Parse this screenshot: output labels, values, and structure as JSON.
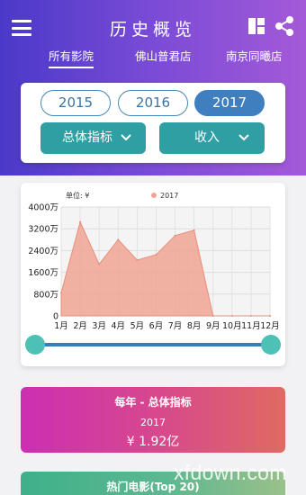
{
  "header": {
    "title": "历史概览",
    "icons": {
      "menu": "menu-icon",
      "grid": "grid-icon",
      "share": "share-icon"
    },
    "tabs": [
      {
        "label": "所有影院",
        "active": true
      },
      {
        "label": "佛山普君店",
        "active": false
      },
      {
        "label": "南京同曦店",
        "active": false
      }
    ]
  },
  "filters": {
    "years": [
      {
        "label": "2015",
        "active": false
      },
      {
        "label": "2016",
        "active": false
      },
      {
        "label": "2017",
        "active": true
      }
    ],
    "dropdowns": [
      {
        "label": "总体指标",
        "icon": "chevron-down-icon"
      },
      {
        "label": "收入",
        "icon": "chevron-down-icon"
      }
    ]
  },
  "chart_data": {
    "type": "area",
    "unit_label": "单位: ¥",
    "legend_position": "top-center",
    "categories": [
      "1月",
      "2月",
      "3月",
      "4月",
      "5月",
      "6月",
      "7月",
      "8月",
      "9月",
      "10月",
      "11月",
      "12月"
    ],
    "y_ticks": [
      "4000万",
      "3200万",
      "2400万",
      "1600万",
      "800万",
      "0"
    ],
    "ylim": [
      0,
      4000
    ],
    "grid": true,
    "series": [
      {
        "name": "2017",
        "color": "#f0a493",
        "values": [
          850,
          3450,
          1900,
          2800,
          2050,
          2250,
          2950,
          3150,
          0,
          0,
          0,
          0
        ]
      }
    ]
  },
  "slider": {
    "start": 0.0,
    "end": 1.0
  },
  "summary_card": {
    "title": "每年 - 总体指标",
    "year": "2017",
    "value": "¥ 1.92亿"
  },
  "top_card": {
    "title": "热门电影(Top 20)"
  },
  "watermark": "xfdown.com"
}
